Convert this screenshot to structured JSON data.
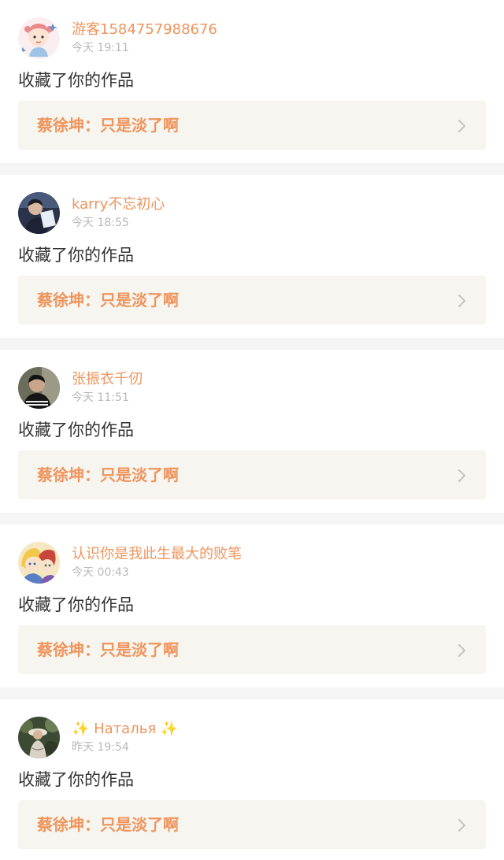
{
  "colors": {
    "accent": "#f0945c",
    "time": "#b8b8b8",
    "text": "#333333",
    "box_bg": "#f6f5ef",
    "page_bg": "#f5f5f5"
  },
  "notifications": [
    {
      "username": "游客1584757988676",
      "time": "今天 19:11",
      "action": "收藏了你的作品",
      "work_title": "蔡徐坤：只是淡了啊",
      "avatar_icon": "cartoon-girl-avatar-icon"
    },
    {
      "username": "karry不忘初心",
      "time": "今天 18:55",
      "action": "收藏了你的作品",
      "work_title": "蔡徐坤：只是淡了啊",
      "avatar_icon": "photo-avatar-icon"
    },
    {
      "username": "张振衣千仞",
      "time": "今天 11:51",
      "action": "收藏了你的作品",
      "work_title": "蔡徐坤：只是淡了啊",
      "avatar_icon": "photo-avatar-icon"
    },
    {
      "username": "认识你是我此生最大的败笔",
      "time": "今天 00:43",
      "action": "收藏了你的作品",
      "work_title": "蔡徐坤：只是淡了啊",
      "avatar_icon": "anime-avatar-icon"
    },
    {
      "username": "✨ Наталья ✨",
      "time": "昨天 19:54",
      "action": "收藏了你的作品",
      "work_title": "蔡徐坤：只是淡了啊",
      "avatar_icon": "photo-avatar-icon"
    }
  ]
}
